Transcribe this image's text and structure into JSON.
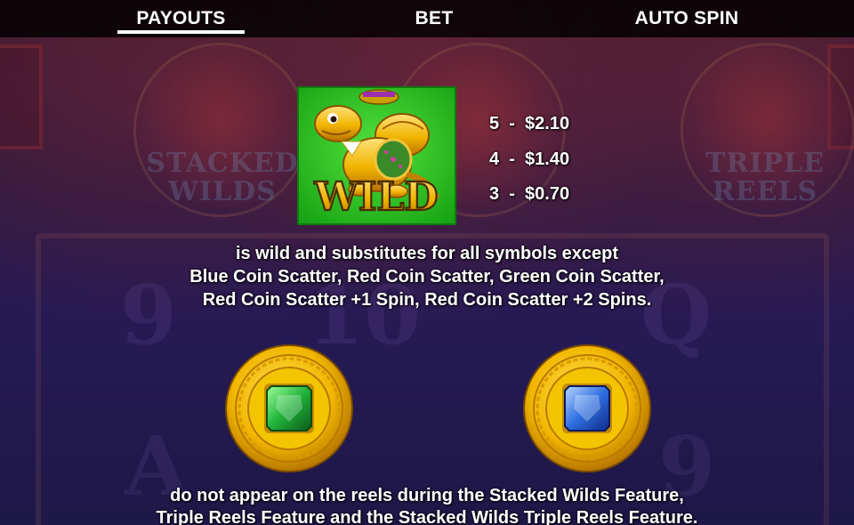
{
  "tabs": [
    {
      "label": "PAYOUTS",
      "active": true
    },
    {
      "label": "BET",
      "active": false
    },
    {
      "label": "AUTO SPIN",
      "active": false
    }
  ],
  "background": {
    "left_feature": "STACKED\nWILDS",
    "right_feature": "TRIPLE\nREELS"
  },
  "wild": {
    "symbol_text": "WILD",
    "icon": "golden-turtle-wild-symbol",
    "payouts": [
      {
        "count": "5",
        "value": "$2.10"
      },
      {
        "count": "4",
        "value": "$1.40"
      },
      {
        "count": "3",
        "value": "$0.70"
      }
    ],
    "description": [
      "is wild and substitutes for all symbols except",
      "Blue Coin Scatter, Red Coin Scatter, Green Coin Scatter,",
      "Red Coin Scatter +1 Spin, Red Coin Scatter +2 Spins."
    ]
  },
  "coins": {
    "icons": [
      "green-coin-scatter-icon",
      "blue-coin-scatter-icon"
    ],
    "description": [
      "do not appear on the reels during the Stacked Wilds Feature,",
      "Triple Reels Feature and the Stacked Wilds Triple Reels Feature."
    ]
  },
  "colors": {
    "wild_bg": "#27c41f",
    "gold": "#f0b800",
    "green_gem": "#1fa83a",
    "blue_gem": "#2f6fe0",
    "tab_bar": "#000000",
    "text": "#ffffff"
  }
}
